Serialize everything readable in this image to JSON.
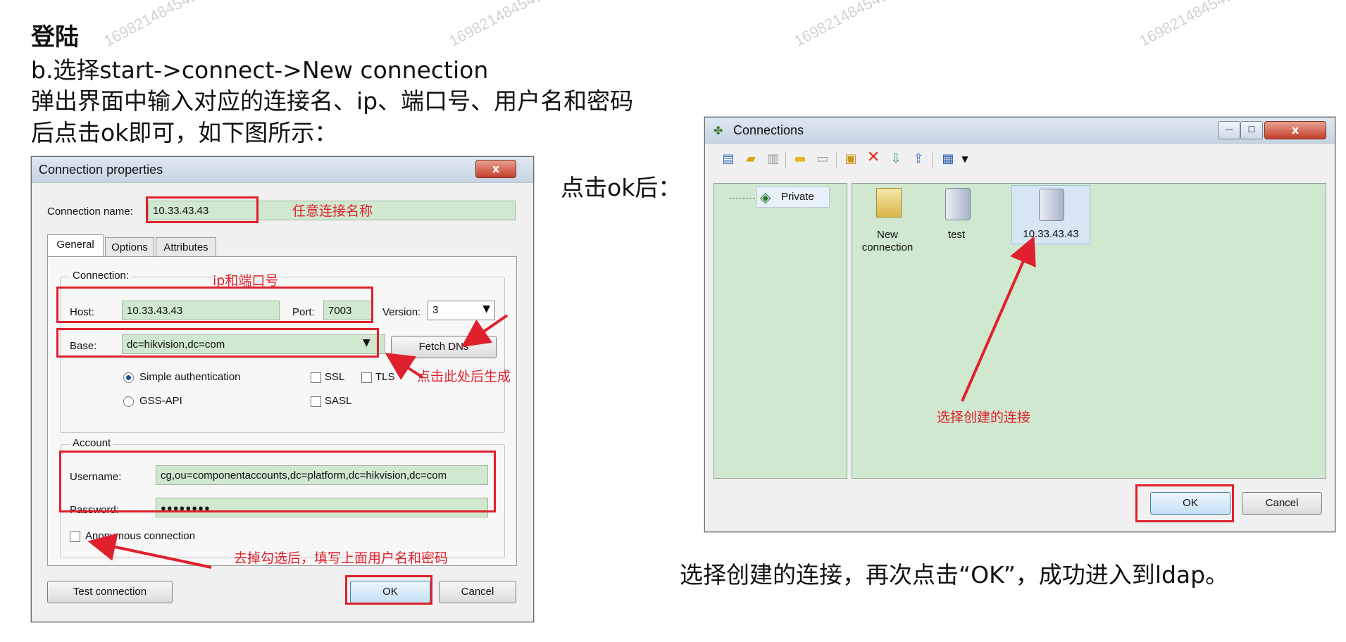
{
  "heading": {
    "title": "登陆",
    "line1": "b.选择start->connect->New connection",
    "line2": "弹出界面中输入对应的连接名、ip、端口号、用户名和密码",
    "line3": "后点击ok即可，如下图所示："
  },
  "middle_caption": "点击ok后：",
  "footer_caption": "选择创建的连接，再次点击“OK”，成功进入到ldap。",
  "watermark": "1698214845419",
  "connection_properties": {
    "title": "Connection properties",
    "close_label": "x",
    "connection_name_label": "Connection name:",
    "connection_name_value": "10.33.43.43",
    "tabs": [
      "General",
      "Options",
      "Attributes"
    ],
    "connection_group_label": "Connection:",
    "host_label": "Host:",
    "host_value": "10.33.43.43",
    "port_label": "Port:",
    "port_value": "7003",
    "version_label": "Version:",
    "version_value": "3",
    "base_label": "Base:",
    "base_value": "dc=hikvision,dc=com",
    "fetch_dns_label": "Fetch DNs",
    "simple_auth_label": "Simple authentication",
    "gss_api_label": "GSS-API",
    "ssl_label": "SSL",
    "tls_label": "TLS",
    "sasl_label": "SASL",
    "account_group_label": "Account",
    "username_label": "Username:",
    "username_value": "cg,ou=componentaccounts,dc=platform,dc=hikvision,dc=com",
    "password_label": "Password:",
    "password_value": "●●●●●●●●",
    "anonymous_label": "Anonymous connection",
    "test_connection_label": "Test connection",
    "ok_label": "OK",
    "cancel_label": "Cancel"
  },
  "annotations": {
    "conn_name_note": "任意连接名称",
    "ip_port_note": "ip和端口号",
    "fetch_note": "点击此处后生成",
    "account_note": "去掉勾选后，填写上面用户名和密码",
    "select_note": "选择创建的连接"
  },
  "connections_window": {
    "title": "Connections",
    "tree_item": "Private",
    "items": [
      {
        "label": "New connection"
      },
      {
        "label": "test"
      },
      {
        "label": "10.33.43.43"
      }
    ],
    "ok_label": "OK",
    "cancel_label": "Cancel"
  }
}
